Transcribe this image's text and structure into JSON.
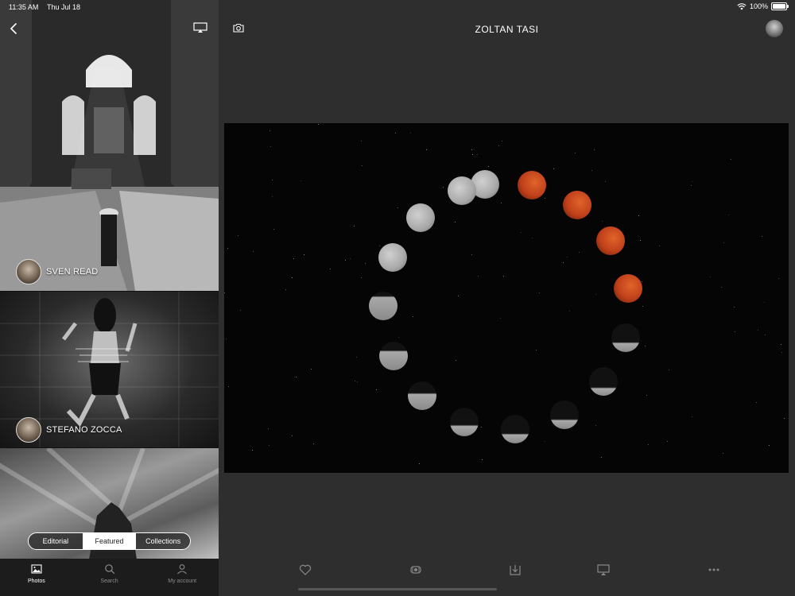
{
  "status_bar": {
    "time": "11:35 AM",
    "date": "Thu Jul 18",
    "battery": "100%",
    "battery_level": 1.0
  },
  "sidebar": {
    "back_icon": "chevron-left-icon",
    "cast_icon": "airplay-icon",
    "tiles": [
      {
        "photographer": "SVEN READ"
      },
      {
        "photographer": "STEFANO ZOCCA"
      },
      {
        "photographer": ""
      }
    ],
    "segments": [
      {
        "label": "Editorial",
        "active": false
      },
      {
        "label": "Featured",
        "active": true
      },
      {
        "label": "Collections",
        "active": false
      }
    ],
    "tabs": [
      {
        "label": "Photos",
        "icon": "photos-icon",
        "active": true
      },
      {
        "label": "Search",
        "icon": "search-icon",
        "active": false
      },
      {
        "label": "My account",
        "icon": "account-icon",
        "active": false
      }
    ]
  },
  "main": {
    "title": "ZOLTAN TASI",
    "camera_icon": "camera-icon",
    "actions": [
      "heart-icon",
      "gallery-icon",
      "download-icon",
      "airplay-icon",
      "more-icon"
    ]
  },
  "colors": {
    "background": "#2e2e2e",
    "sidebar": "#111111",
    "accent": "#ffffff",
    "moon_red": "#c0401a",
    "moon_grey": "#a8a8a8"
  }
}
